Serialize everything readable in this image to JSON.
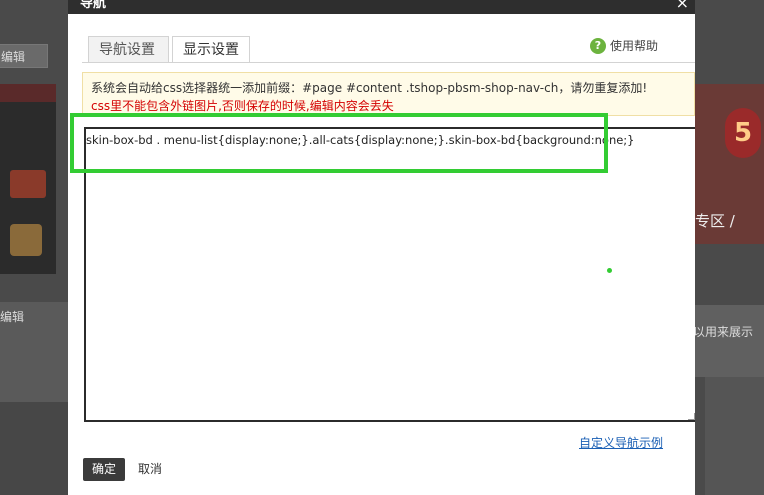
{
  "background": {
    "left_edit_label": "编辑",
    "left_panel_label": "编辑",
    "right_circle_text": "5",
    "right_zone_text": "专区 /",
    "right_grey_text": "以用来展示"
  },
  "modal": {
    "title": "导航",
    "close_symbol": "×",
    "tabs": [
      {
        "label": "导航设置",
        "active": false
      },
      {
        "label": "显示设置",
        "active": true
      }
    ],
    "help_label": "使用帮助",
    "notice_line1": "系统会自动给css选择器统一添加前缀：#page #content .tshop-pbsm-shop-nav-ch，请勿重复添加!",
    "notice_line2": "css里不能包含外链图片,否则保存的时候,编辑内容会丢失",
    "css_content": "skin-box-bd . menu-list{display:none;}.all-cats{display:none;}.skin-box-bd{background:none;}",
    "example_link": "自定义导航示例",
    "confirm_label": "确定",
    "cancel_label": "取消"
  },
  "colors": {
    "highlight": "#33cc33",
    "notice_bg": "#fffbe8",
    "warning_text": "#d40000",
    "link": "#1a5fb4",
    "confirm_bg": "#3b3b3b"
  }
}
